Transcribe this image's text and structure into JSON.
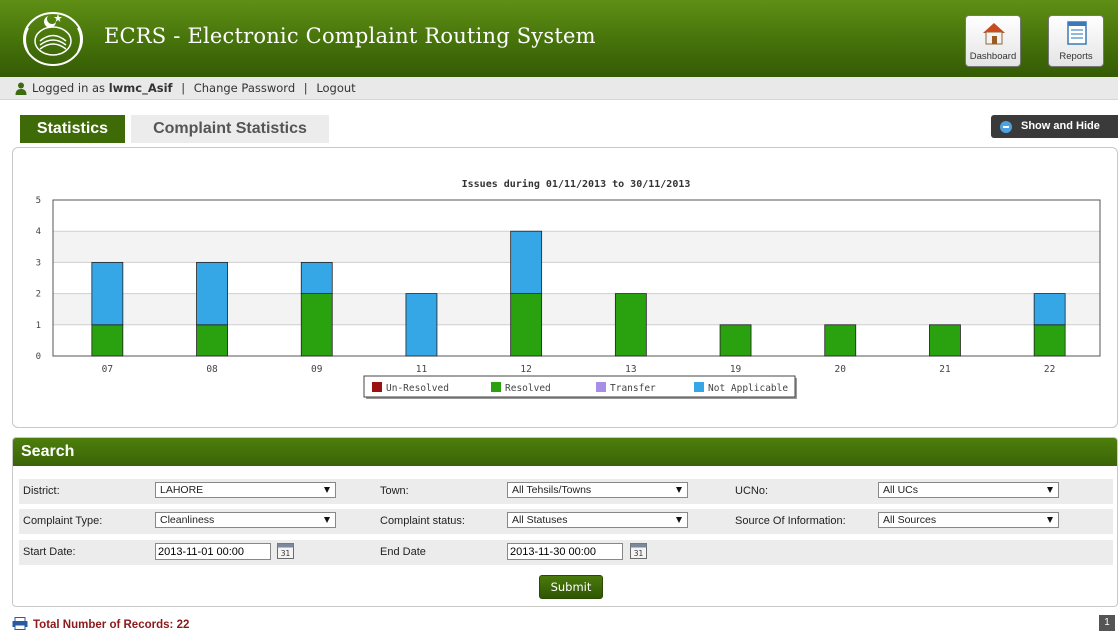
{
  "header": {
    "title": "ECRS - Electronic Complaint Routing System",
    "buttons": {
      "dashboard": "Dashboard",
      "reports": "Reports"
    }
  },
  "userbar": {
    "prefix": "Logged in as",
    "username": "lwmc_Asif",
    "separator": "|",
    "change_password": "Change Password",
    "logout": "Logout"
  },
  "tabs": {
    "statistics": "Statistics",
    "complaint_statistics": "Complaint Statistics"
  },
  "show_hide": "Show and Hide",
  "chart_data": {
    "type": "bar",
    "stacked": true,
    "title": "Issues during 01/11/2013 to 30/11/2013",
    "categories": [
      "07",
      "08",
      "09",
      "11",
      "12",
      "13",
      "19",
      "20",
      "21",
      "22"
    ],
    "series": [
      {
        "name": "Un-Resolved",
        "color": "#9b1111",
        "values": [
          0,
          0,
          0,
          0,
          0,
          0,
          0,
          0,
          0,
          0
        ]
      },
      {
        "name": "Resolved",
        "color": "#2aa10f",
        "values": [
          1,
          1,
          2,
          0,
          2,
          2,
          1,
          1,
          1,
          1
        ]
      },
      {
        "name": "Transfer",
        "color": "#a98ee8",
        "values": [
          0,
          0,
          0,
          0,
          0,
          0,
          0,
          0,
          0,
          0
        ]
      },
      {
        "name": "Not Applicable",
        "color": "#36a7e6",
        "values": [
          2,
          2,
          1,
          2,
          2,
          0,
          0,
          0,
          0,
          1
        ]
      }
    ],
    "ylim": [
      0,
      5
    ],
    "yticks": [
      "0",
      "1",
      "2",
      "3",
      "4",
      "5"
    ],
    "grid": true,
    "legend": "bottom-center"
  },
  "search": {
    "heading": "Search",
    "row1": {
      "district_label": "District:",
      "district_value": "LAHORE",
      "town_label": "Town:",
      "town_value": "All Tehsils/Towns",
      "ucno_label": "UCNo:",
      "ucno_value": "All UCs"
    },
    "row2": {
      "complaint_type_label": "Complaint Type:",
      "complaint_type_value": "Cleanliness",
      "complaint_status_label": "Complaint status:",
      "complaint_status_value": "All Statuses",
      "source_label": "Source Of Information:",
      "source_value": "All Sources"
    },
    "row3": {
      "start_label": "Start Date:",
      "start_value": "2013-11-01 00:00",
      "end_label": "End Date",
      "end_value": "2013-11-30 00:00",
      "calendar_day": "31"
    },
    "submit": "Submit"
  },
  "footer": {
    "total_label": "Total Number of Records:",
    "total_value": "22",
    "page": "1"
  },
  "colors": {
    "brand_green": "#3f6a08",
    "total_text": "#8b1a1a"
  }
}
